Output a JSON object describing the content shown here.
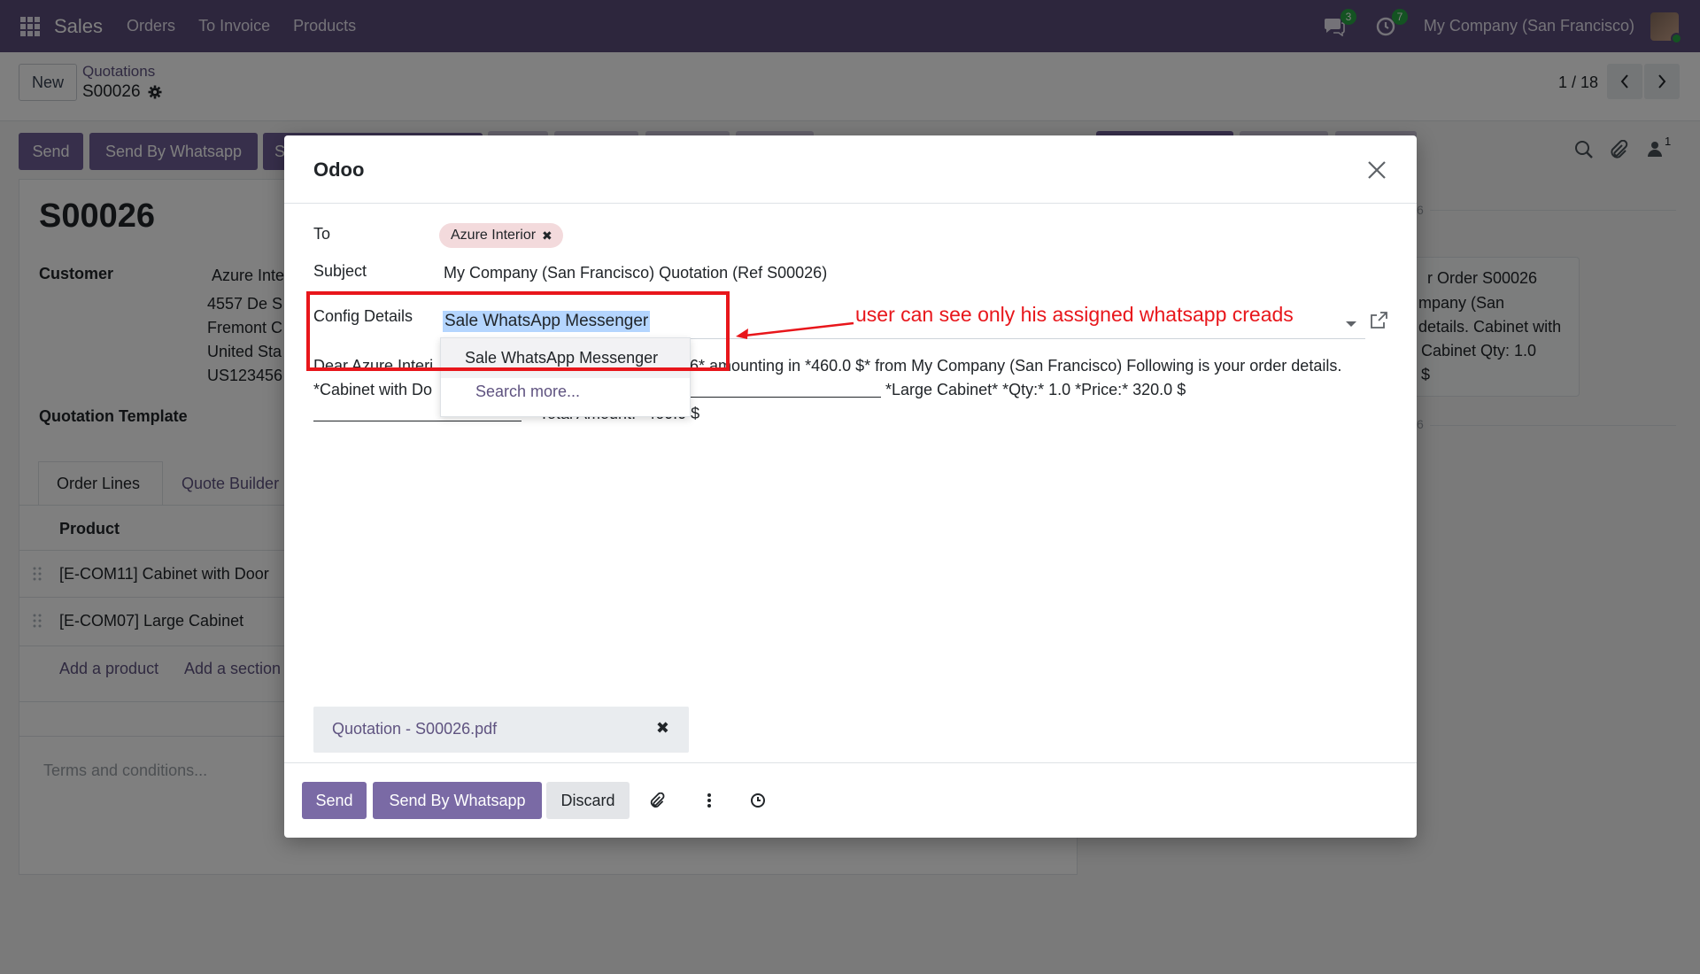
{
  "navbar": {
    "app_name": "Sales",
    "menu": [
      "Orders",
      "To Invoice",
      "Products"
    ],
    "messages_count": "3",
    "activities_count": "7",
    "company": "My Company (San Francisco)"
  },
  "control_panel": {
    "new_label": "New",
    "breadcrumb_parent": "Quotations",
    "record_name": "S00026",
    "pager": "1 / 18"
  },
  "form_bg": {
    "buttons": {
      "send": "Send",
      "send_whatsapp": "Send By Whatsapp",
      "third": "S"
    },
    "title": "S00026",
    "customer_label": "Customer",
    "customer_name": "Azure Inte",
    "address": [
      "4557 De S",
      "Fremont C",
      "United Sta",
      "US123456"
    ],
    "quotation_template_label": "Quotation Template",
    "tabs": [
      "Order Lines",
      "Quote Builder"
    ],
    "product_header": "Product",
    "lines": [
      "[E-COM11] Cabinet with Door",
      "[E-COM07] Large Cabinet"
    ],
    "add_product": "Add a product",
    "add_section": "Add a section",
    "terms_placeholder": "Terms and conditions...",
    "chatter_number": "6",
    "chatter_number_2": "6",
    "chatter_message": [
      "r Order S00026",
      "mpany (San",
      "details. Cabinet with",
      "Cabinet Qty: 1.0",
      "$"
    ],
    "follower_count": "1"
  },
  "modal": {
    "title": "Odoo",
    "to_label": "To",
    "recipient": "Azure Interior",
    "subject_label": "Subject",
    "subject": "My Company (San Francisco) Quotation (Ref S00026)",
    "config_label": "Config Details",
    "config_value": "Sale WhatsApp Messenger",
    "dropdown": {
      "option": "Sale WhatsApp Messenger",
      "search_more": "Search more..."
    },
    "body": {
      "line1_start": "Dear Azure Interi",
      "line1_end": "6* amounting in *460.0 $* from My Company (San Francisco) Following is your order details.",
      "line2_start": "*Cabinet with Do",
      "line2_end": "*Large Cabinet* *Qty:* 1.0 *Price:* 320.0 $",
      "line3": "*Total Amount:* 460.0 $"
    },
    "attachment": "Quotation - S00026.pdf",
    "footer": {
      "send": "Send",
      "send_whatsapp": "Send By Whatsapp",
      "discard": "Discard"
    }
  },
  "annotation": {
    "text": "user can see only his assigned whatsapp creads",
    "color": "#e8161b"
  },
  "colors": {
    "navbar": "#5a4c7a",
    "primary": "#7a6aa5",
    "link": "#5f5380"
  }
}
